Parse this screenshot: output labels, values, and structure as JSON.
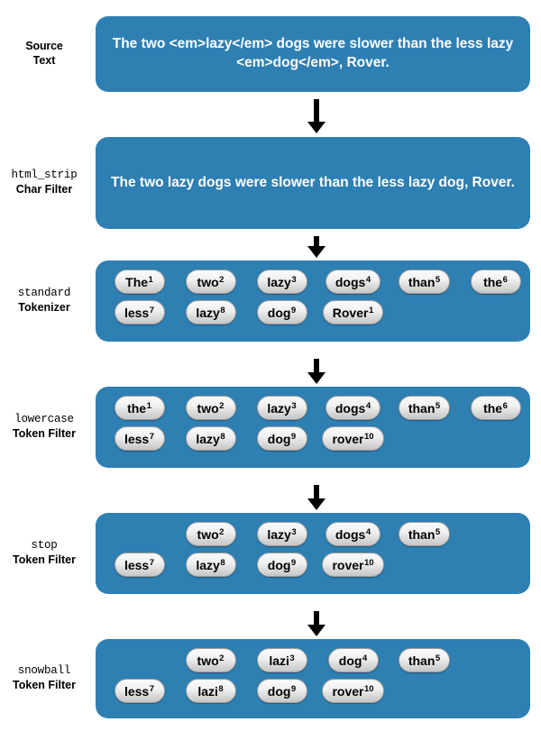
{
  "diagram": {
    "title": "Analysis chain: source text through char filter, tokenizer and token filters",
    "accent_color": "#2e7fb2",
    "background_color": "#ffffff",
    "arrow_color": "#000000"
  },
  "stages": [
    {
      "label_line1": "Source",
      "label_line2": "Text",
      "label_line1_mono": false,
      "type": "text",
      "text": "The two <em>lazy</em> dogs were slower than the less lazy <em>dog</em>, Rover."
    },
    {
      "label_line1": "html_strip",
      "label_line2": "Char Filter",
      "label_line1_mono": true,
      "type": "text",
      "text": "The two lazy dogs were slower than the less lazy dog, Rover."
    },
    {
      "label_line1": "standard",
      "label_line2": "Tokenizer",
      "label_line1_mono": true,
      "type": "tokens",
      "rows": [
        [
          {
            "word": "The",
            "pos": "1"
          },
          {
            "word": "two",
            "pos": "2"
          },
          {
            "word": "lazy",
            "pos": "3"
          },
          {
            "word": "dogs",
            "pos": "4"
          },
          {
            "word": "than",
            "pos": "5"
          },
          {
            "word": "the",
            "pos": "6"
          }
        ],
        [
          {
            "word": "less",
            "pos": "7"
          },
          {
            "word": "lazy",
            "pos": "8"
          },
          {
            "word": "dog",
            "pos": "9"
          },
          {
            "word": "Rover",
            "pos": "1"
          }
        ]
      ]
    },
    {
      "label_line1": "lowercase",
      "label_line2": "Token Filter",
      "label_line1_mono": true,
      "type": "tokens",
      "rows": [
        [
          {
            "word": "the",
            "pos": "1"
          },
          {
            "word": "two",
            "pos": "2"
          },
          {
            "word": "lazy",
            "pos": "3"
          },
          {
            "word": "dogs",
            "pos": "4"
          },
          {
            "word": "than",
            "pos": "5"
          },
          {
            "word": "the",
            "pos": "6"
          }
        ],
        [
          {
            "word": "less",
            "pos": "7"
          },
          {
            "word": "lazy",
            "pos": "8"
          },
          {
            "word": "dog",
            "pos": "9"
          },
          {
            "word": "rover",
            "pos": "10"
          }
        ]
      ]
    },
    {
      "label_line1": "stop",
      "label_line2": "Token Filter",
      "label_line1_mono": true,
      "type": "tokens",
      "rows": [
        [
          {
            "word": "",
            "pos": "",
            "empty": true
          },
          {
            "word": "two",
            "pos": "2"
          },
          {
            "word": "lazy",
            "pos": "3"
          },
          {
            "word": "dogs",
            "pos": "4"
          },
          {
            "word": "than",
            "pos": "5"
          }
        ],
        [
          {
            "word": "less",
            "pos": "7"
          },
          {
            "word": "lazy",
            "pos": "8"
          },
          {
            "word": "dog",
            "pos": "9"
          },
          {
            "word": "rover",
            "pos": "10"
          }
        ]
      ]
    },
    {
      "label_line1": "snowball",
      "label_line2": "Token Filter",
      "label_line1_mono": true,
      "type": "tokens",
      "rows": [
        [
          {
            "word": "",
            "pos": "",
            "empty": true
          },
          {
            "word": "two",
            "pos": "2"
          },
          {
            "word": "lazi",
            "pos": "3"
          },
          {
            "word": "dog",
            "pos": "4"
          },
          {
            "word": "than",
            "pos": "5"
          }
        ],
        [
          {
            "word": "less",
            "pos": "7"
          },
          {
            "word": "lazi",
            "pos": "8"
          },
          {
            "word": "dog",
            "pos": "9"
          },
          {
            "word": "rover",
            "pos": "10"
          }
        ]
      ]
    }
  ],
  "geometry": {
    "stage_tops": [
      18,
      152,
      289,
      429,
      569,
      709
    ],
    "box_heights": [
      84,
      102,
      90,
      90,
      90,
      88
    ],
    "arrow_tops": [
      110,
      262,
      398,
      538,
      678
    ],
    "arrow_heights": [
      38,
      24,
      28,
      28,
      28
    ]
  }
}
